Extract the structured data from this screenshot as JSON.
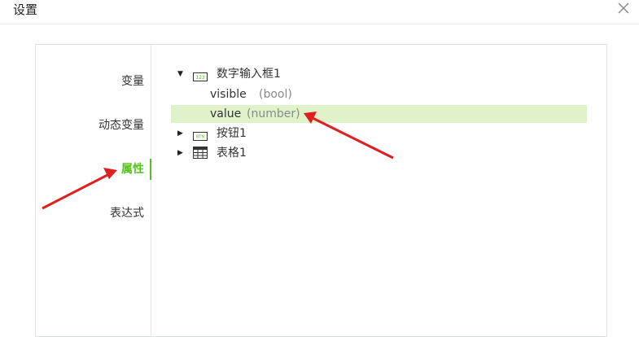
{
  "dialog": {
    "title": "设置"
  },
  "nav": {
    "items": [
      {
        "label": "变量",
        "active": false
      },
      {
        "label": "动态变量",
        "active": false
      },
      {
        "label": "属性",
        "active": true
      },
      {
        "label": "表达式",
        "active": false
      }
    ]
  },
  "tree": {
    "nodes": [
      {
        "label": "数字输入框1",
        "icon": "number-input-icon",
        "icon_text": "123",
        "expanded": true,
        "props": [
          {
            "name": "visible",
            "type": "(bool)"
          },
          {
            "name": "value",
            "type": "(number)",
            "selected": true
          }
        ]
      },
      {
        "label": "按钮1",
        "icon": "button-icon",
        "icon_text": "BTN",
        "expanded": false
      },
      {
        "label": "表格1",
        "icon": "table-icon",
        "expanded": false
      }
    ]
  },
  "colors": {
    "accent": "#52c41a",
    "selected_row": "#dff2c9",
    "annotation_arrow": "#e02020"
  }
}
